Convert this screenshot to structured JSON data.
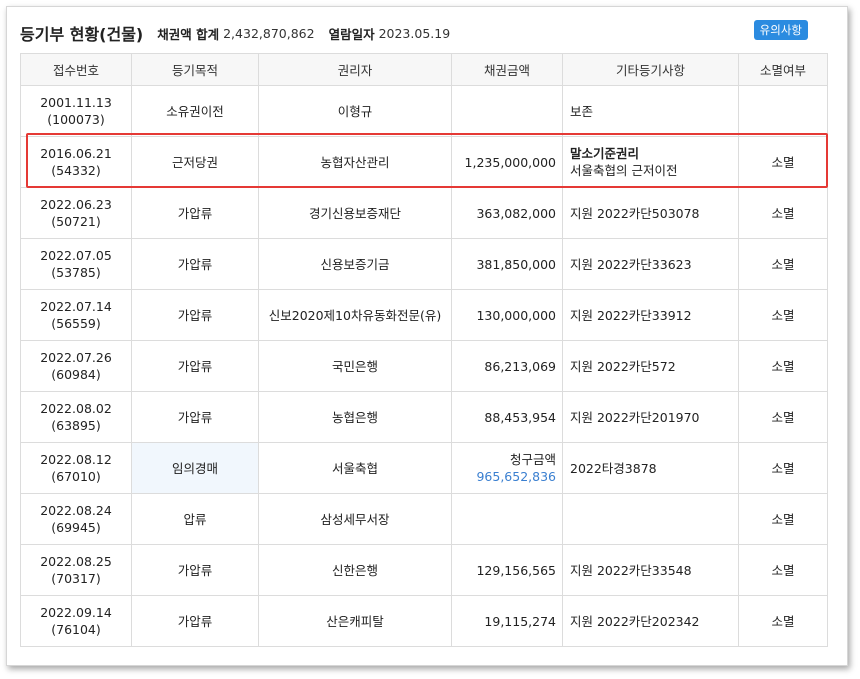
{
  "header": {
    "title": "등기부 현황(건물)",
    "total_label": "채권액 합계",
    "total_value": "2,432,870,862",
    "date_label": "열람일자",
    "date_value": "2023.05.19",
    "notice_button": "유의사항"
  },
  "table": {
    "columns": [
      "접수번호",
      "등기목적",
      "권리자",
      "채권금액",
      "기타등기사항",
      "소멸여부"
    ],
    "rows": [
      {
        "date": "2001.11.13",
        "no": "(100073)",
        "purpose": "소유권이전",
        "holder": "이형규",
        "amount": "",
        "etc": "보존",
        "etc2": "",
        "status": ""
      },
      {
        "date": "2016.06.21",
        "no": "(54332)",
        "purpose": "근저당권",
        "holder": "농협자산관리",
        "amount": "1,235,000,000",
        "etc": "말소기준권리",
        "etc2": "서울축협의 근저이전",
        "status": "소멸"
      },
      {
        "date": "2022.06.23",
        "no": "(50721)",
        "purpose": "가압류",
        "holder": "경기신용보증재단",
        "amount": "363,082,000",
        "etc": "지원 2022카단503078",
        "etc2": "",
        "status": "소멸"
      },
      {
        "date": "2022.07.05",
        "no": "(53785)",
        "purpose": "가압류",
        "holder": "신용보증기금",
        "amount": "381,850,000",
        "etc": "지원 2022카단33623",
        "etc2": "",
        "status": "소멸"
      },
      {
        "date": "2022.07.14",
        "no": "(56559)",
        "purpose": "가압류",
        "holder": "신보2020제10차유동화전문(유)",
        "amount": "130,000,000",
        "etc": "지원 2022카단33912",
        "etc2": "",
        "status": "소멸"
      },
      {
        "date": "2022.07.26",
        "no": "(60984)",
        "purpose": "가압류",
        "holder": "국민은행",
        "amount": "86,213,069",
        "etc": "지원 2022카단572",
        "etc2": "",
        "status": "소멸"
      },
      {
        "date": "2022.08.02",
        "no": "(63895)",
        "purpose": "가압류",
        "holder": "농협은행",
        "amount": "88,453,954",
        "etc": "지원 2022카단201970",
        "etc2": "",
        "status": "소멸"
      },
      {
        "date": "2022.08.12",
        "no": "(67010)",
        "purpose": "임의경매",
        "holder": "서울축협",
        "amount_label": "청구금액",
        "amount_value": "965,652,836",
        "etc": "2022타경3878",
        "etc2": "",
        "status": "소멸"
      },
      {
        "date": "2022.08.24",
        "no": "(69945)",
        "purpose": "압류",
        "holder": "삼성세무서장",
        "amount": "",
        "etc": "",
        "etc2": "",
        "status": "소멸"
      },
      {
        "date": "2022.08.25",
        "no": "(70317)",
        "purpose": "가압류",
        "holder": "신한은행",
        "amount": "129,156,565",
        "etc": "지원 2022카단33548",
        "etc2": "",
        "status": "소멸"
      },
      {
        "date": "2022.09.14",
        "no": "(76104)",
        "purpose": "가압류",
        "holder": "산은캐피탈",
        "amount": "19,115,274",
        "etc": "지원 2022카단202342",
        "etc2": "",
        "status": "소멸"
      }
    ]
  },
  "colors": {
    "accent": "#2b8be0",
    "highlight_border": "#e53935",
    "claim_value": "#3a7fd0",
    "auction_cell_bg": "#f1f7fd"
  }
}
